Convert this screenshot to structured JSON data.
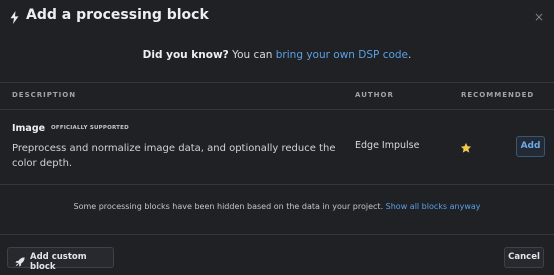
{
  "header": {
    "title": "Add a processing block",
    "bolt_icon": "lightning-bolt-icon",
    "close_icon": "close-icon",
    "close_glyph": "×"
  },
  "tip": {
    "prefix": "Did you know?",
    "middle": "You can",
    "link": "bring your own DSP code",
    "suffix": "."
  },
  "table": {
    "columns": [
      "DESCRIPTION",
      "AUTHOR",
      "RECOMMENDED"
    ],
    "rows": [
      {
        "title": "Image",
        "badge": "OFFICIALLY SUPPORTED",
        "description": "Preprocess and normalize image data, and optionally reduce the color depth.",
        "author": "Edge Impulse",
        "recommended": true,
        "recommended_icon": "star-icon",
        "action_label": "Add"
      }
    ]
  },
  "hidden_note": {
    "text": "Some processing blocks have been hidden based on the data in your project.",
    "link": "Show all blocks anyway"
  },
  "footer": {
    "custom_label": "Add custom block",
    "custom_icon": "rocket-icon",
    "cancel_label": "Cancel"
  },
  "colors": {
    "background": "#1f2124",
    "link": "#5aa0e6",
    "star": "#f2c94c"
  }
}
